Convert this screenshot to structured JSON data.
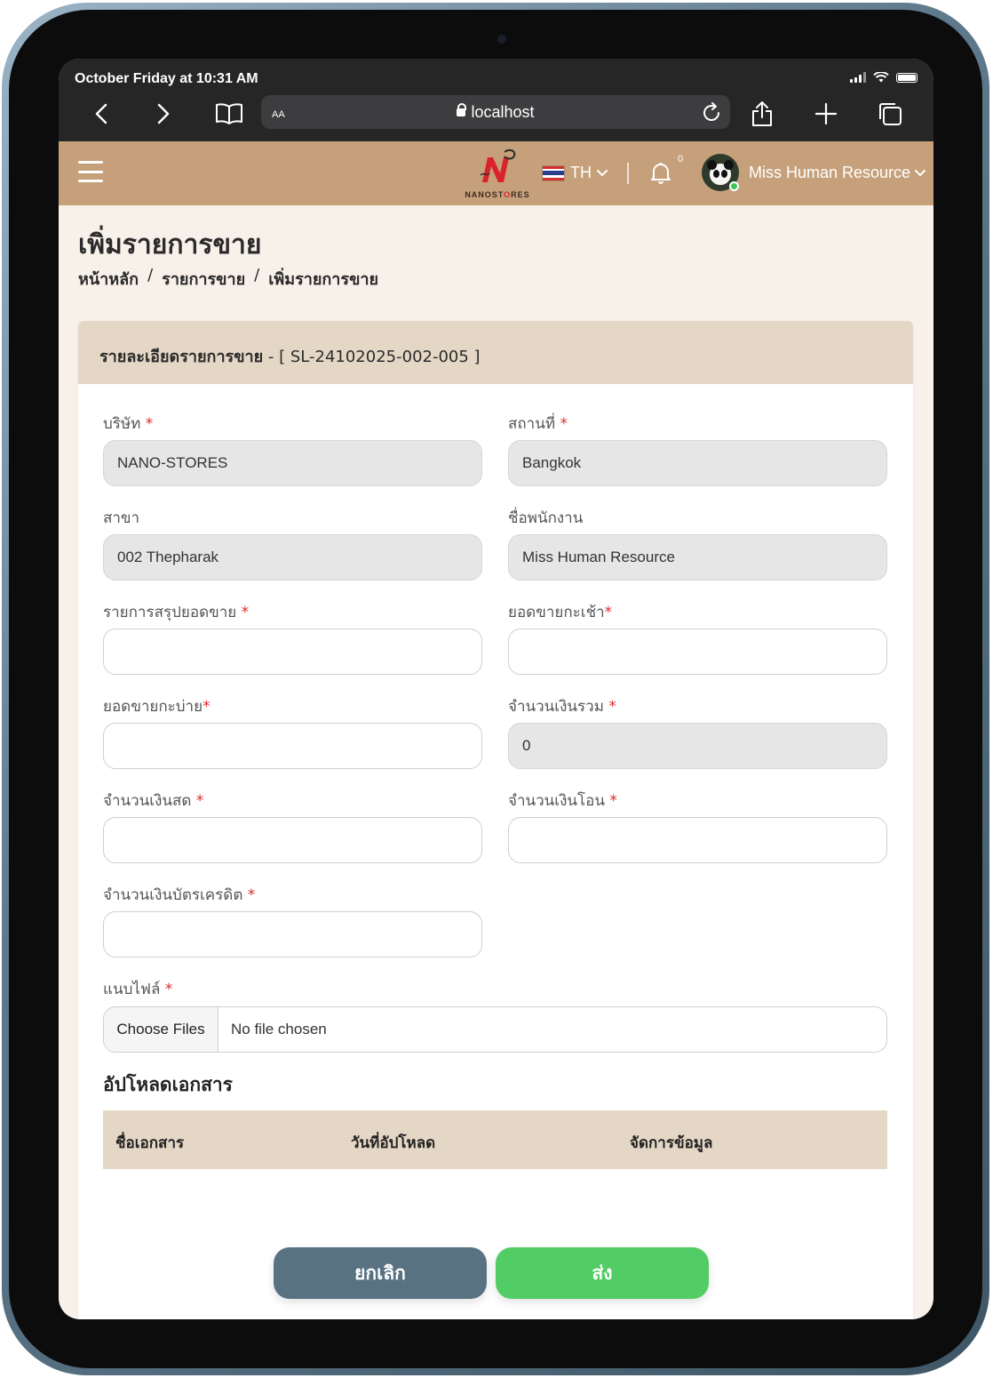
{
  "status_bar": {
    "time": "October Friday at 10:31 AM"
  },
  "browser": {
    "aa_label": "AA",
    "url": "localhost"
  },
  "header": {
    "logo_text_a": "NANO",
    "logo_text_b": "ST",
    "logo_text_c": "O",
    "logo_text_d": "RES",
    "language": "TH",
    "notification_count": "0",
    "user_name": "Miss Human Resource"
  },
  "page": {
    "title": "เพิ่มรายการขาย",
    "breadcrumb": [
      "หน้าหลัก",
      "รายการขาย",
      "เพิ่มรายการขาย"
    ],
    "breadcrumb_sep": "/"
  },
  "card": {
    "header_label": "รายละเอียดรายการขาย",
    "header_code": " - [ SL-24102025-002-005 ]"
  },
  "form": {
    "required_mark": "*",
    "company": {
      "label": "บริษัท",
      "value": "NANO-STORES"
    },
    "location": {
      "label": "สถานที่",
      "value": "Bangkok"
    },
    "branch": {
      "label": "สาขา",
      "value": "002 Thepharak"
    },
    "employee": {
      "label": "ชื่อพนักงาน",
      "value": "Miss Human Resource"
    },
    "sales_summary": {
      "label": "รายการสรุปยอดขาย",
      "value": ""
    },
    "morning_sales": {
      "label": "ยอดขายกะเช้า",
      "value": ""
    },
    "afternoon_sales": {
      "label": "ยอดขายกะบ่าย",
      "value": ""
    },
    "total_amount": {
      "label": "จำนวนเงินรวม",
      "value": "0"
    },
    "cash_amount": {
      "label": "จำนวนเงินสด",
      "value": ""
    },
    "transfer_amount": {
      "label": "จำนวนเงินโอน",
      "value": ""
    },
    "credit_amount": {
      "label": "จำนวนเงินบัตรเครดิต",
      "value": ""
    },
    "attachment": {
      "label": "แนบไฟล์",
      "button": "Choose Files",
      "status": "No file chosen"
    }
  },
  "documents": {
    "title": "อัปโหลดเอกสาร",
    "columns": [
      "ชื่อเอกสาร",
      "วันที่อัปโหลด",
      "จัดการข้อมูล"
    ]
  },
  "actions": {
    "cancel": "ยกเลิก",
    "submit": "ส่ง"
  },
  "colors": {
    "header_bg": "#c6a07a",
    "card_header_bg": "#e5d7c6",
    "cancel": "#587282",
    "submit": "#52cc64",
    "required": "#e02b2b"
  }
}
